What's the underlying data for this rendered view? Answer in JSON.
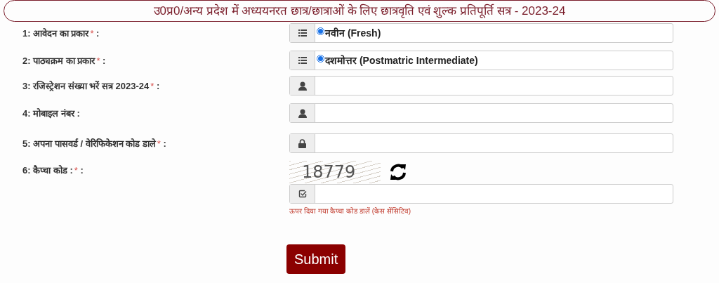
{
  "title": "उ0प्र0/अन्य प्रदेश में अध्ययनरत छात्र/छात्राओं के लिए छात्रवृति एवं शुल्क प्रतिपूर्ति सत्र - 2023-24",
  "fields": [
    {
      "kind": "radio",
      "label": "1: आवेदन का प्रकार",
      "mark": "*",
      "suffix": " :",
      "option": "नवीन (Fresh)",
      "checked": true
    },
    {
      "kind": "radio",
      "label": "2: पाठ्यक्रम का प्रकार",
      "mark": "*",
      "suffix": " :",
      "option": "दशमोत्तर (Postmatric Intermediate)",
      "checked": true
    },
    {
      "kind": "user",
      "label": "3: रजिस्ट्रेशन संख्या भरें सत्र 2023-24",
      "mark": "*",
      "suffix": " :"
    },
    {
      "kind": "user",
      "label": "4: मोबाइल नंबर :"
    },
    {
      "kind": "lock",
      "label": "5: अपना पासवर्ड / वेरिफिकेशन कोड डाले",
      "mark": "*",
      "suffix": " :"
    },
    {
      "kind": "captcha",
      "label": "6: कैप्चा कोड :",
      "mark": "*",
      "suffix": " :",
      "code": "18779",
      "hint": "ऊपर दिया गया कैप्चा कोड डालें (केस सेंसिटिव)"
    }
  ],
  "submit": "Submit"
}
